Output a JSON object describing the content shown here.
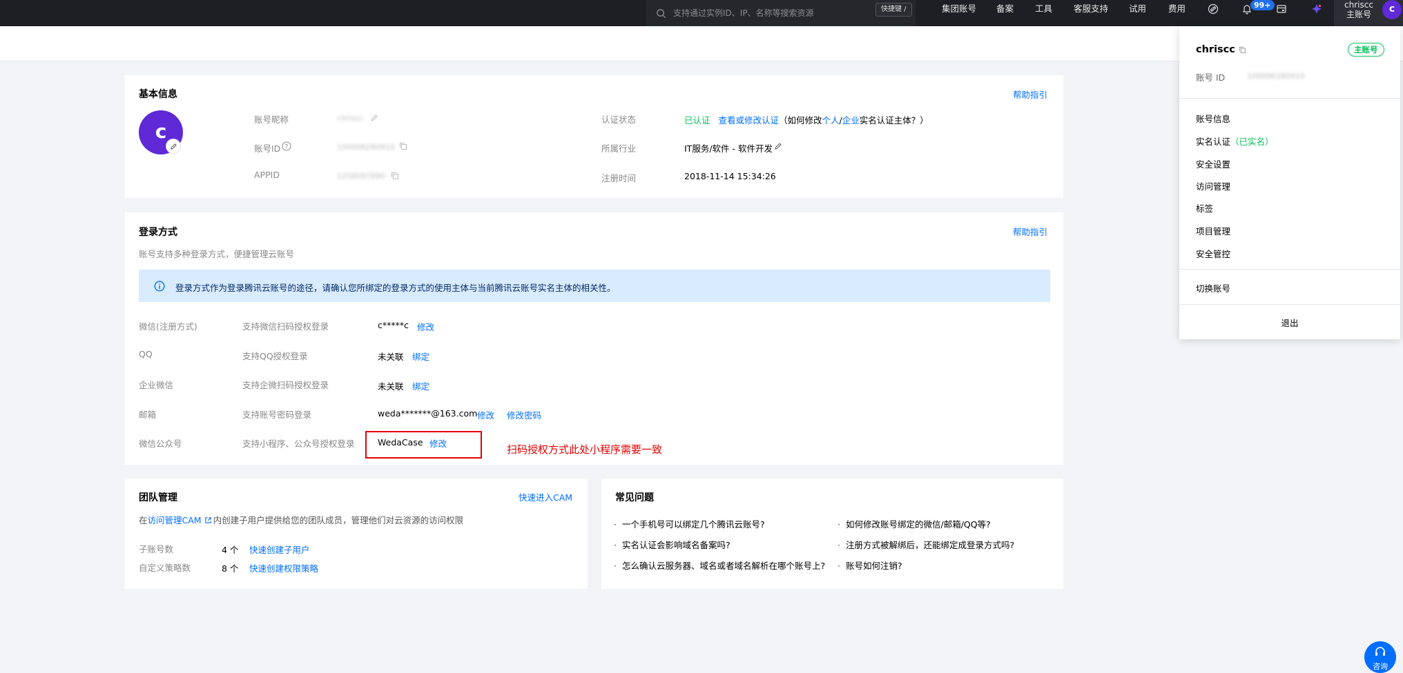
{
  "topbar": {
    "search_placeholder": "支持通过实例ID、IP、名称等搜索资源",
    "shortcut": "快捷键 /",
    "nav": [
      "集团账号",
      "备案",
      "工具",
      "客服支持",
      "试用",
      "费用"
    ],
    "notification_count": "99+",
    "username": "chriscc",
    "account_type": "主账号",
    "avatar_letter": "c"
  },
  "basic_info": {
    "title": "基本信息",
    "help": "帮助指引",
    "avatar_letter": "c",
    "nickname_label": "账号昵称",
    "nickname_value": "chriscc",
    "account_id_label": "账号ID",
    "account_id_value": "100006280910",
    "appid_label": "APPID",
    "appid_value": "1258097890",
    "auth_label": "认证状态",
    "auth_status": "已认证",
    "auth_link": "查看或修改认证",
    "auth_hint_pre": "（如何修改",
    "auth_hint_personal": "个人",
    "auth_hint_sep": "/",
    "auth_hint_company": "企业",
    "auth_hint_post": "实名认证主体？）",
    "industry_label": "所属行业",
    "industry_value": "IT服务/软件 - 软件开发",
    "reg_label": "注册时间",
    "reg_value": "2018-11-14 15:34:26"
  },
  "login": {
    "title": "登录方式",
    "help": "帮助指引",
    "subtitle": "账号支持多种登录方式，便捷管理云账号",
    "notice": "登录方式作为登录腾讯云账号的途径，请确认您所绑定的登录方式的使用主体与当前腾讯云账号实名主体的相关性。",
    "rows": [
      {
        "name": "微信(注册方式)",
        "desc": "支持微信扫码授权登录",
        "value": "c*****c",
        "action": "修改",
        "action2": ""
      },
      {
        "name": "QQ",
        "desc": "支持QQ授权登录",
        "value": "未关联",
        "action": "绑定",
        "action2": ""
      },
      {
        "name": "企业微信",
        "desc": "支持企微扫码授权登录",
        "value": "未关联",
        "action": "绑定",
        "action2": ""
      },
      {
        "name": "邮箱",
        "desc": "支持账号密码登录",
        "value": "weda*******@163.com",
        "action": "修改",
        "action2": "修改密码"
      },
      {
        "name": "微信公众号",
        "desc": "支持小程序、公众号授权登录",
        "value": "WedaCase",
        "action": "修改",
        "action2": ""
      }
    ],
    "annotation": "扫码授权方式此处小程序需要一致"
  },
  "team": {
    "title": "团队管理",
    "cam_link": "快速进入CAM",
    "desc_pre": "在",
    "desc_link": "访问管理CAM",
    "desc_post": "内创建子用户提供给您的团队成员，管理他们对云资源的访问权限",
    "sub_label": "子账号数",
    "sub_value": "4 个",
    "sub_action": "快速创建子用户",
    "policy_label": "自定义策略数",
    "policy_value": "8 个",
    "policy_action": "快速创建权限策略"
  },
  "faq": {
    "title": "常见问题",
    "left": [
      "一个手机号可以绑定几个腾讯云账号?",
      "实名认证会影响域名备案吗?",
      "怎么确认云服务器、域名或者域名解析在哪个账号上?"
    ],
    "right": [
      "如何修改账号绑定的微信/邮箱/QQ等?",
      "注册方式被解绑后，还能绑定成登录方式吗?",
      "账号如何注销?"
    ]
  },
  "dropdown": {
    "username": "chriscc",
    "tag": "主账号",
    "id_label": "账号 ID",
    "id_value": "100006280910",
    "items": [
      "账号信息",
      "实名认证",
      "安全设置",
      "访问管理",
      "标签",
      "项目管理",
      "安全管控"
    ],
    "verified": "（已实名）",
    "switch": "切换账号",
    "logout": "退出"
  },
  "chat": {
    "label": "咨询"
  },
  "colors": {
    "accent": "#006eff",
    "success": "#0abf5b",
    "danger": "#e30000",
    "brand": "#5f29d8"
  }
}
